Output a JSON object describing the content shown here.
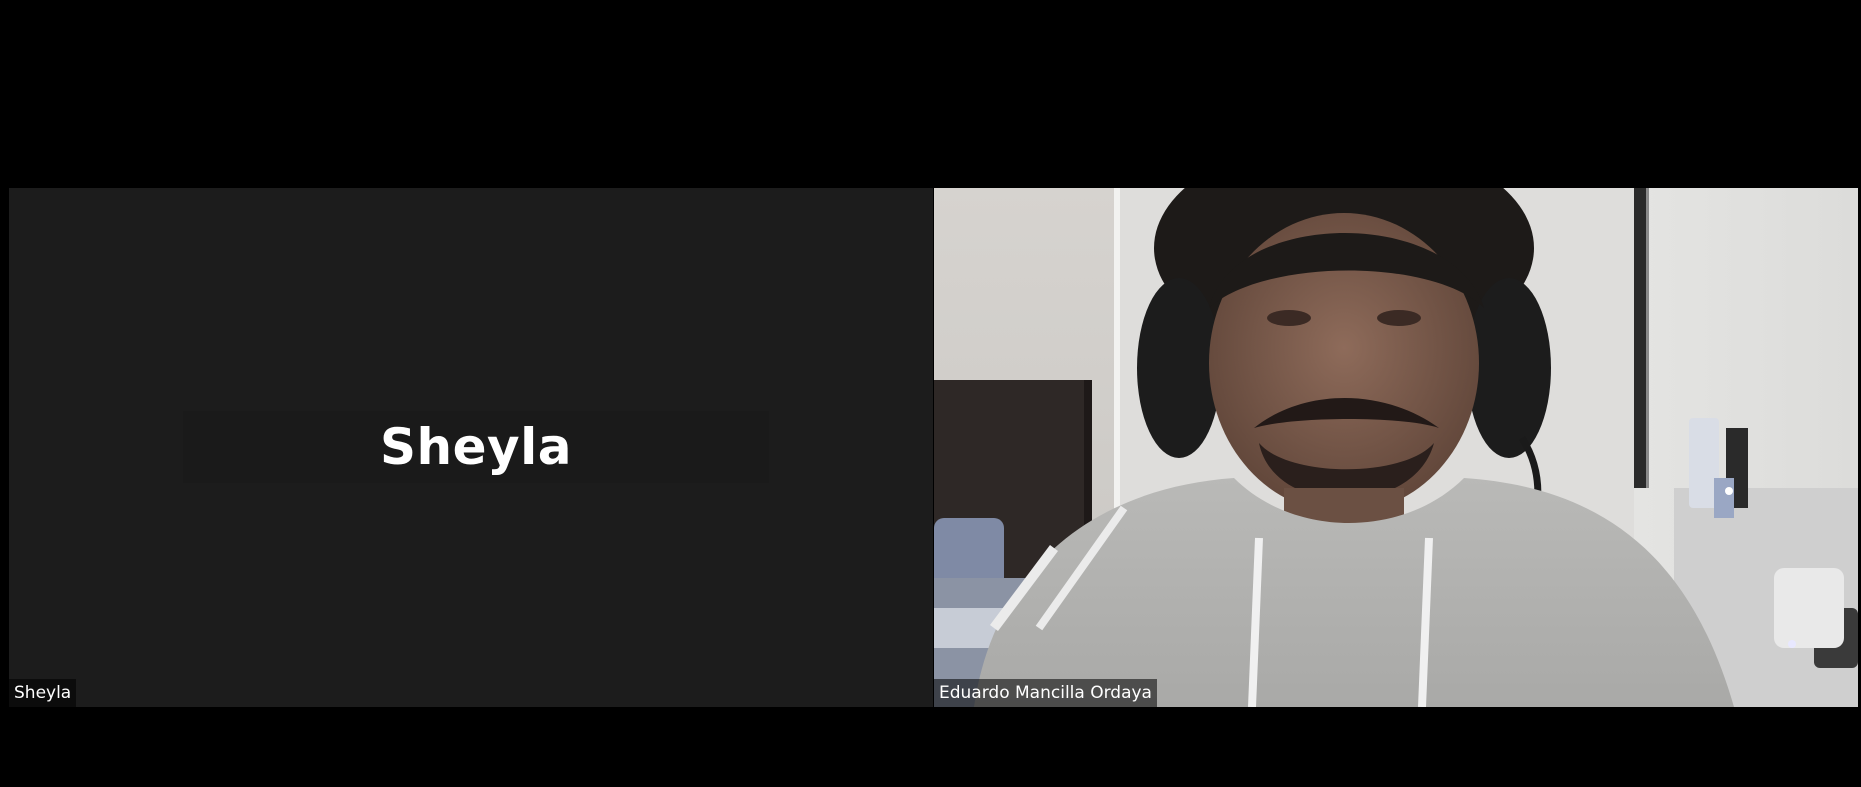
{
  "meeting": {
    "participants": [
      {
        "name": "Sheyla",
        "display_name": "Sheyla",
        "video_on": false
      },
      {
        "name": "Eduardo Mancilla Ordaya",
        "video_on": true
      }
    ]
  },
  "colors": {
    "background": "#000000",
    "tile_off": "#1c1c1c",
    "name_tag_text": "#ffffff"
  }
}
